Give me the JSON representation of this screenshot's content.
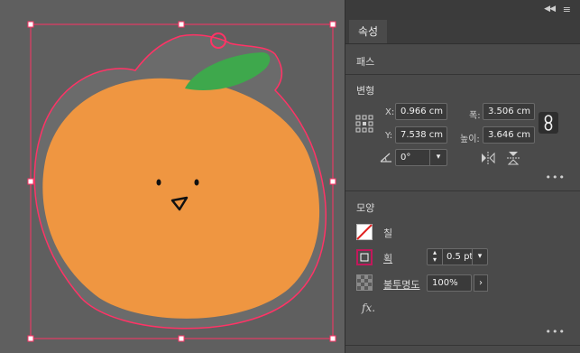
{
  "panel": {
    "tab_label": "속성",
    "path_section": "패스",
    "transform": {
      "title": "변형",
      "x_label": "X:",
      "x_value": "0.966 cm",
      "y_label": "Y:",
      "y_value": "7.538 cm",
      "width_label": "폭:",
      "width_value": "3.506 cm",
      "height_label": "높이:",
      "height_value": "3.646 cm",
      "rotate_value": "0°"
    },
    "appearance": {
      "title": "모양",
      "fill_label": "칠",
      "stroke_label": "획",
      "stroke_weight": "0.5 pt",
      "opacity_label": "불투명도",
      "opacity_value": "100%",
      "fx_label": "fx."
    },
    "more_dots": "•••"
  },
  "colors": {
    "selection": "#ff3366",
    "orange": "#ef9641",
    "leaf": "#3ea84c",
    "panel_bg": "#4a4a4a",
    "canvas_bg": "#5f5f5f",
    "stroke_swatch": "#c2185b"
  },
  "icons": {
    "reference_point": "reference-point-grid-icon",
    "link": "constrain-proportions-link-icon",
    "flip_h": "flip-horizontal-icon",
    "flip_v": "flip-vertical-icon",
    "rotate": "rotate-angle-icon",
    "fill_none": "fill-none-swatch-icon",
    "stroke": "stroke-swatch-icon",
    "opacity": "opacity-checker-icon",
    "fx": "fx-effects-icon"
  }
}
